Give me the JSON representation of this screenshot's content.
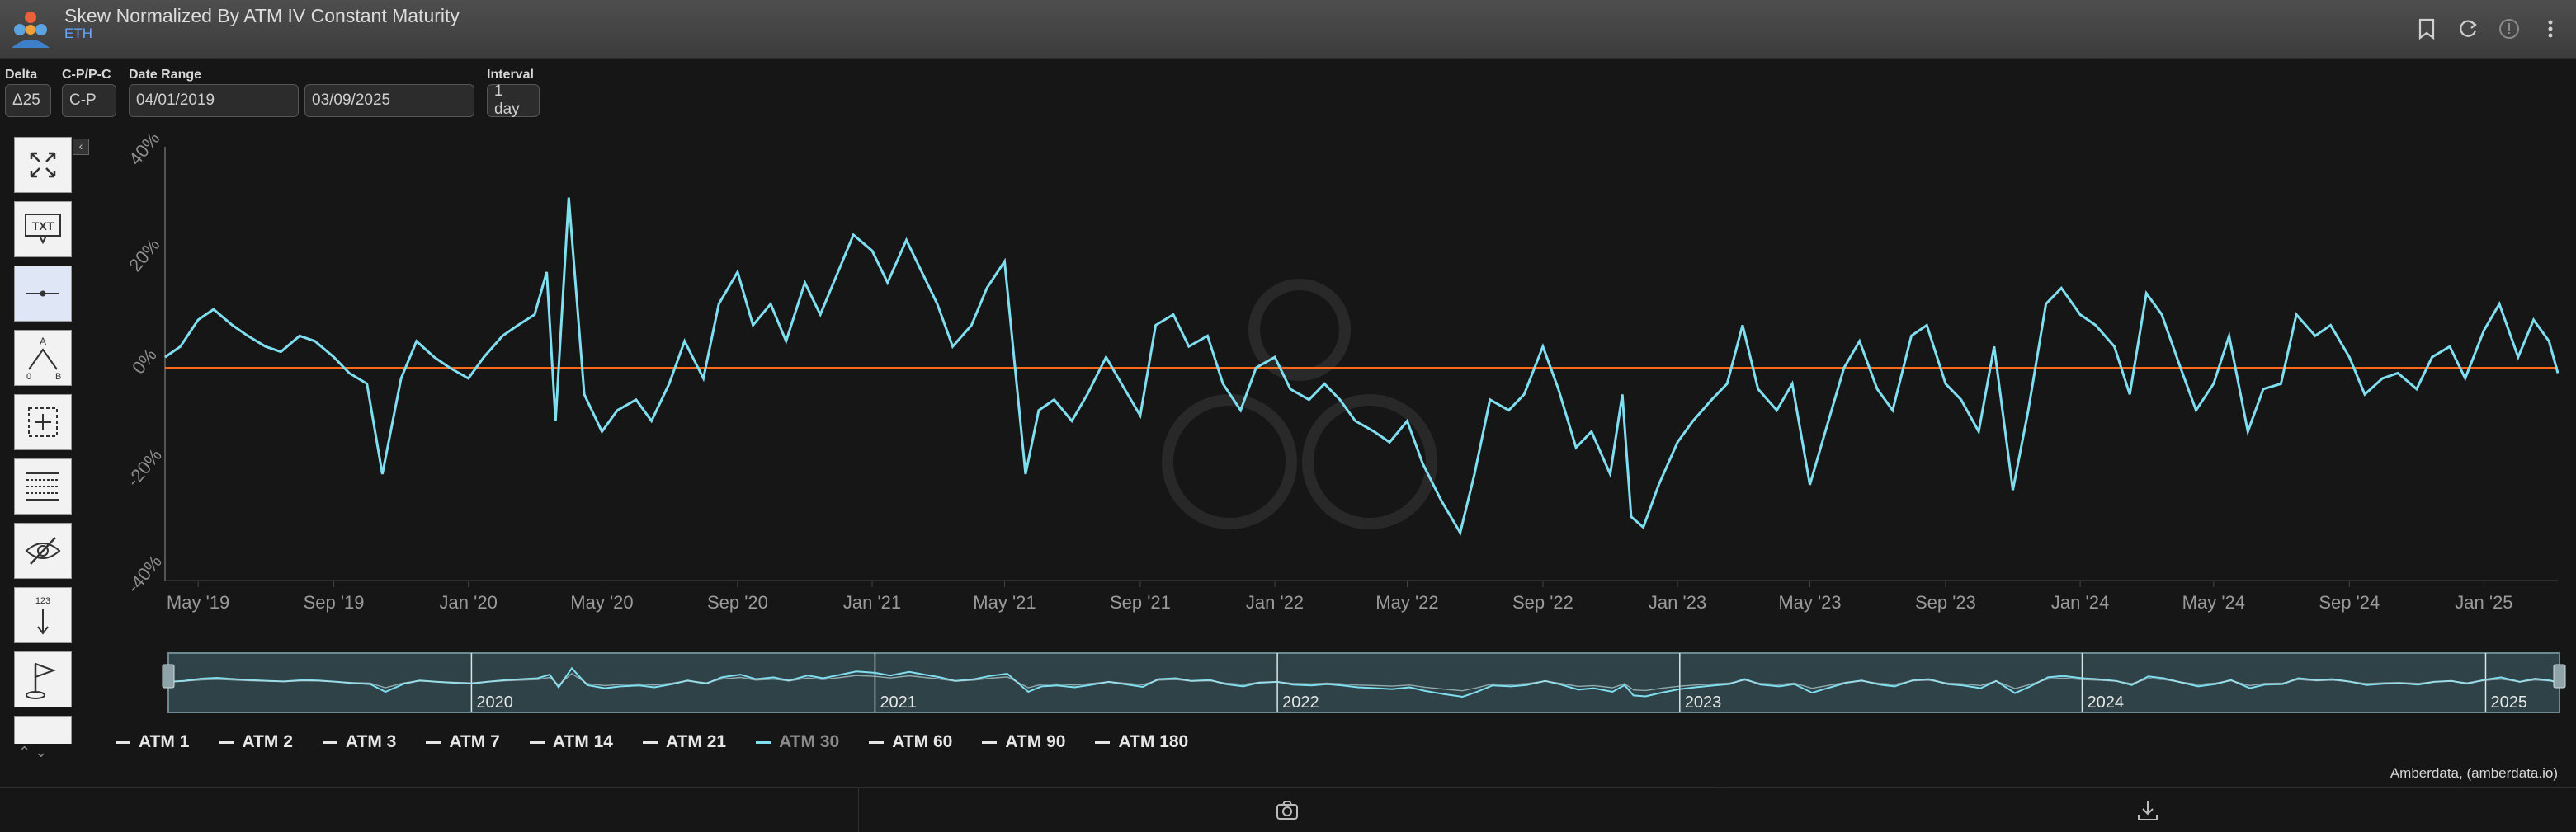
{
  "header": {
    "title": "Skew Normalized By ATM IV Constant Maturity",
    "asset": "ETH",
    "icons": [
      "bookmark-icon",
      "refresh-icon",
      "info-icon",
      "more-vertical-icon"
    ]
  },
  "controls": {
    "delta_label": "Delta",
    "delta_value": "Δ25",
    "cp_label": "C-P/P-C",
    "cp_value": "C-P",
    "date_range_label": "Date Range",
    "start_date": "04/01/2019",
    "end_date": "03/09/2025",
    "interval_label": "Interval",
    "interval_value": "1 day"
  },
  "toolbar": {
    "tools": [
      "fullscreen-icon",
      "text-annotation-icon",
      "horizontal-line-icon",
      "measure-ab-icon",
      "crosshair-select-icon",
      "table-icon",
      "hide-icon",
      "numbered-icon",
      "flag-icon"
    ]
  },
  "legend": {
    "items": [
      {
        "label": "ATM 1",
        "active": true
      },
      {
        "label": "ATM 2",
        "active": true
      },
      {
        "label": "ATM 3",
        "active": true
      },
      {
        "label": "ATM 7",
        "active": true
      },
      {
        "label": "ATM 14",
        "active": true
      },
      {
        "label": "ATM 21",
        "active": true
      },
      {
        "label": "ATM 30",
        "active": false
      },
      {
        "label": "ATM 60",
        "active": true
      },
      {
        "label": "ATM 90",
        "active": true
      },
      {
        "label": "ATM 180",
        "active": true
      }
    ]
  },
  "credit": "Amberdata, (amberdata.io)",
  "footer_icons": [
    "camera-icon",
    "download-icon"
  ],
  "colors": {
    "series": "#7fdff0",
    "zero_line": "#ff6a1a",
    "navigator_fill": "#2f4247"
  },
  "chart_data": {
    "type": "line",
    "title": "Skew Normalized By ATM IV Constant Maturity",
    "ylim": [
      -40,
      40
    ],
    "y_ticks": [
      "-40%",
      "-20%",
      "0%",
      "20%",
      "40%"
    ],
    "y_tick_values": [
      -40,
      -20,
      0,
      20,
      40
    ],
    "x_ticks": [
      "May '19",
      "Sep '19",
      "Jan '20",
      "May '20",
      "Sep '20",
      "Jan '21",
      "May '21",
      "Sep '21",
      "Jan '22",
      "May '22",
      "Sep '22",
      "Jan '23",
      "May '23",
      "Sep '23",
      "Jan '24",
      "May '24",
      "Sep '24",
      "Jan '25"
    ],
    "x_tick_dates": [
      "2019-05-01",
      "2019-09-01",
      "2020-01-01",
      "2020-05-01",
      "2020-09-01",
      "2021-01-01",
      "2021-05-01",
      "2021-09-01",
      "2022-01-01",
      "2022-05-01",
      "2022-09-01",
      "2023-01-01",
      "2023-05-01",
      "2023-09-01",
      "2024-01-01",
      "2024-05-01",
      "2024-09-01",
      "2025-01-01"
    ],
    "x_range": [
      "2019-04-01",
      "2025-03-09"
    ],
    "reference_line": 0,
    "navigator_labels": [
      "2020",
      "2021",
      "2022",
      "2023",
      "2024",
      "2025"
    ],
    "series": [
      {
        "name": "ATM 30",
        "dates": [
          "2019-04-01",
          "2019-04-15",
          "2019-05-01",
          "2019-05-15",
          "2019-06-01",
          "2019-06-15",
          "2019-07-01",
          "2019-07-15",
          "2019-08-01",
          "2019-08-15",
          "2019-09-01",
          "2019-09-15",
          "2019-10-01",
          "2019-10-15",
          "2019-11-01",
          "2019-11-15",
          "2019-12-01",
          "2019-12-15",
          "2020-01-01",
          "2020-01-15",
          "2020-02-01",
          "2020-02-15",
          "2020-03-01",
          "2020-03-12",
          "2020-03-20",
          "2020-04-01",
          "2020-04-15",
          "2020-05-01",
          "2020-05-15",
          "2020-06-01",
          "2020-06-15",
          "2020-07-01",
          "2020-07-15",
          "2020-08-01",
          "2020-08-15",
          "2020-09-01",
          "2020-09-15",
          "2020-10-01",
          "2020-10-15",
          "2020-11-01",
          "2020-11-15",
          "2020-12-01",
          "2020-12-15",
          "2021-01-01",
          "2021-01-15",
          "2021-02-01",
          "2021-02-15",
          "2021-03-01",
          "2021-03-15",
          "2021-04-01",
          "2021-04-15",
          "2021-05-01",
          "2021-05-20",
          "2021-06-01",
          "2021-06-15",
          "2021-07-01",
          "2021-07-15",
          "2021-08-01",
          "2021-08-15",
          "2021-09-01",
          "2021-09-15",
          "2021-10-01",
          "2021-10-15",
          "2021-11-01",
          "2021-11-15",
          "2021-12-01",
          "2021-12-15",
          "2022-01-01",
          "2022-01-15",
          "2022-02-01",
          "2022-02-15",
          "2022-03-01",
          "2022-03-15",
          "2022-04-01",
          "2022-04-15",
          "2022-05-01",
          "2022-05-15",
          "2022-06-01",
          "2022-06-18",
          "2022-07-01",
          "2022-07-15",
          "2022-08-01",
          "2022-08-15",
          "2022-09-01",
          "2022-09-15",
          "2022-10-01",
          "2022-10-15",
          "2022-11-01",
          "2022-11-12",
          "2022-11-20",
          "2022-12-01",
          "2022-12-15",
          "2023-01-01",
          "2023-01-15",
          "2023-02-01",
          "2023-02-15",
          "2023-03-01",
          "2023-03-15",
          "2023-04-01",
          "2023-04-15",
          "2023-05-01",
          "2023-05-15",
          "2023-06-01",
          "2023-06-15",
          "2023-07-01",
          "2023-07-15",
          "2023-08-01",
          "2023-08-15",
          "2023-09-01",
          "2023-09-15",
          "2023-10-01",
          "2023-10-15",
          "2023-11-01",
          "2023-11-15",
          "2023-12-01",
          "2023-12-15",
          "2024-01-01",
          "2024-01-15",
          "2024-02-01",
          "2024-02-15",
          "2024-03-01",
          "2024-03-15",
          "2024-04-01",
          "2024-04-15",
          "2024-05-01",
          "2024-05-15",
          "2024-06-01",
          "2024-06-15",
          "2024-07-01",
          "2024-07-15",
          "2024-08-01",
          "2024-08-15",
          "2024-09-01",
          "2024-09-15",
          "2024-10-01",
          "2024-10-15",
          "2024-11-01",
          "2024-11-15",
          "2024-12-01",
          "2024-12-15",
          "2025-01-01",
          "2025-01-15",
          "2025-02-01",
          "2025-02-15",
          "2025-03-01",
          "2025-03-09"
        ],
        "values": [
          2,
          4,
          9,
          11,
          8,
          6,
          4,
          3,
          6,
          5,
          2,
          -1,
          -3,
          -20,
          -2,
          5,
          2,
          0,
          -2,
          2,
          6,
          8,
          10,
          18,
          -10,
          32,
          -5,
          -12,
          -8,
          -6,
          -10,
          -3,
          5,
          -2,
          12,
          18,
          8,
          12,
          5,
          16,
          10,
          18,
          25,
          22,
          16,
          24,
          18,
          12,
          4,
          8,
          15,
          20,
          -20,
          -8,
          -6,
          -10,
          -5,
          2,
          -3,
          -9,
          8,
          10,
          4,
          6,
          -3,
          -8,
          0,
          2,
          -4,
          -6,
          -3,
          -6,
          -10,
          -12,
          -14,
          -10,
          -18,
          -25,
          -31,
          -20,
          -6,
          -8,
          -5,
          4,
          -4,
          -15,
          -12,
          -20,
          -5,
          -28,
          -30,
          -22,
          -14,
          -10,
          -6,
          -3,
          8,
          -4,
          -8,
          -3,
          -22,
          -12,
          0,
          5,
          -4,
          -8,
          6,
          8,
          -3,
          -6,
          -12,
          4,
          -23,
          -8,
          12,
          15,
          10,
          8,
          4,
          -5,
          14,
          10,
          0,
          -8,
          -3,
          6,
          -12,
          -4,
          -3,
          10,
          6,
          8,
          2,
          -5,
          -2,
          -1,
          -4,
          2,
          4,
          -2,
          7,
          12,
          2,
          9,
          5,
          -1,
          4,
          -2,
          -4
        ],
        "color": "#7fdff0"
      }
    ]
  }
}
